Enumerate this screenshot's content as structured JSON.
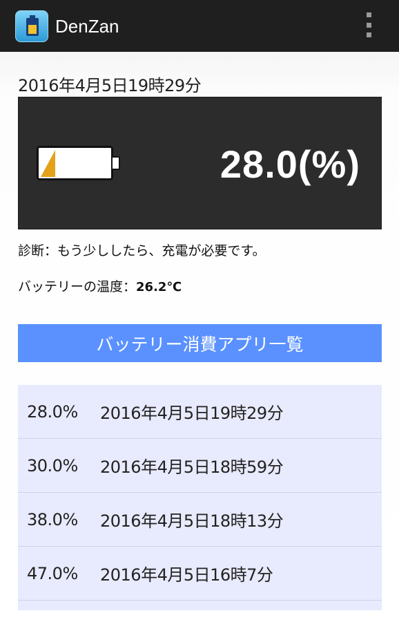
{
  "app": {
    "title": "DenZan",
    "icon": "battery-app-icon",
    "menu_icon": "overflow-menu-icon"
  },
  "status": {
    "timestamp": "2016年4月5日19時29分",
    "battery_percent_text": "28.0(%)",
    "battery_level": 0.28,
    "battery_fill_color": "#e3a21a",
    "diagnosis": "診断：もう少ししたら、充電が必要です。",
    "temperature_label": "バッテリーの温度：",
    "temperature_value": "26.2℃"
  },
  "apps_button_label": "バッテリー消費アプリ一覧",
  "history": [
    {
      "percent": "28.0%",
      "time": "2016年4月5日19時29分"
    },
    {
      "percent": "30.0%",
      "time": "2016年4月5日18時59分"
    },
    {
      "percent": "38.0%",
      "time": "2016年4月5日18時13分"
    },
    {
      "percent": "47.0%",
      "time": "2016年4月5日16時7分"
    }
  ],
  "colors": {
    "actionbar": "#1f1f1f",
    "button": "#5a91ff",
    "list_background": "#e8eafd"
  }
}
